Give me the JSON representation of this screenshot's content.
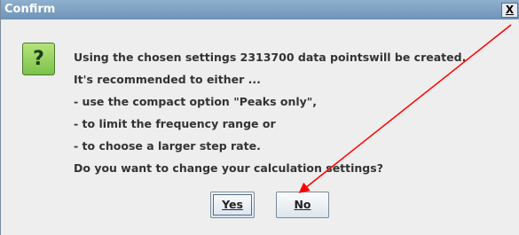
{
  "dialog": {
    "title": "Confirm",
    "close_label": "X",
    "icon": "question-icon",
    "icon_glyph": "?",
    "message_lines": [
      "Using the chosen settings 2313700 data pointswill be created.",
      "It's recommended to either ...",
      "- use the compact option \"Peaks only\",",
      "- to limit the frequency range or",
      "- to choose a larger step rate.",
      "Do you want to change your calculation settings?"
    ],
    "yes_label": "Yes",
    "no_label": "No"
  },
  "annotation": {
    "type": "arrow",
    "color": "#ff0000"
  }
}
